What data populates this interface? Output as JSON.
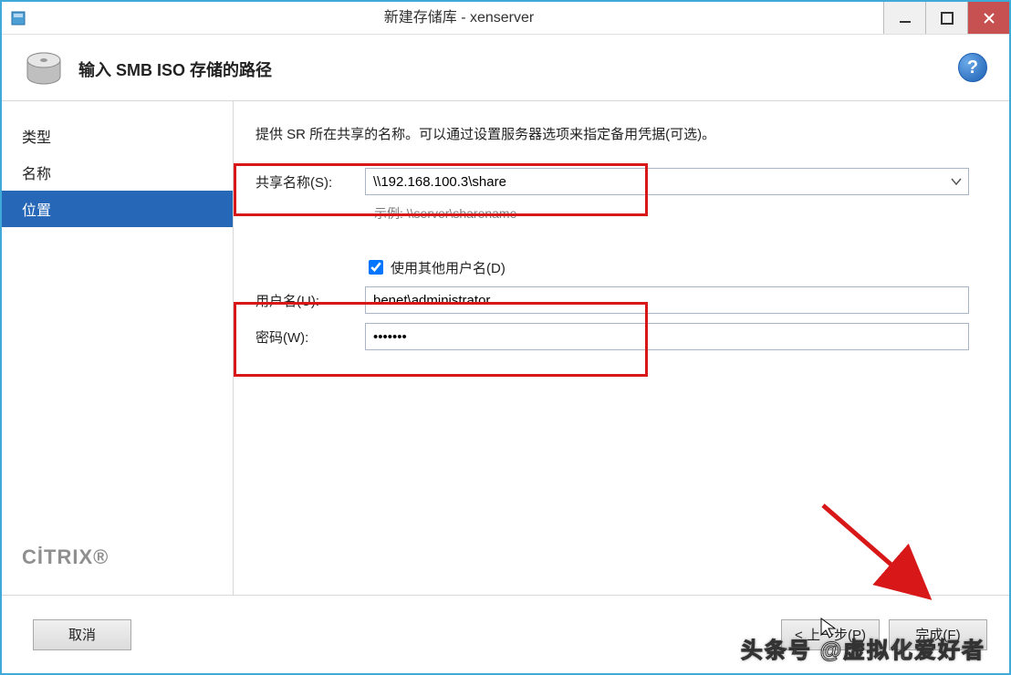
{
  "title": "新建存储库 - xenserver",
  "header": {
    "heading": "输入 SMB ISO 存储的路径"
  },
  "sidebar": {
    "items": [
      {
        "label": "类型",
        "selected": false
      },
      {
        "label": "名称",
        "selected": false
      },
      {
        "label": "位置",
        "selected": true
      }
    ],
    "brand": "CİTRIX"
  },
  "content": {
    "description": "提供 SR 所在共享的名称。可以通过设置服务器选项来指定备用凭据(可选)。",
    "share_label": "共享名称(S):",
    "share_value": "\\\\192.168.100.3\\share",
    "example_label": "示例: \\\\server\\sharename",
    "use_other_label": "使用其他用户名(D)",
    "use_other_checked": true,
    "username_label": "用户名(U):",
    "username_value": "benet\\administrator",
    "password_label": "密码(W):",
    "password_value": "•••••••"
  },
  "footer": {
    "cancel": "取消",
    "prev": "< 上一步(P)",
    "finish": "完成(F)"
  },
  "watermark": "头条号 @虚拟化爱好者"
}
